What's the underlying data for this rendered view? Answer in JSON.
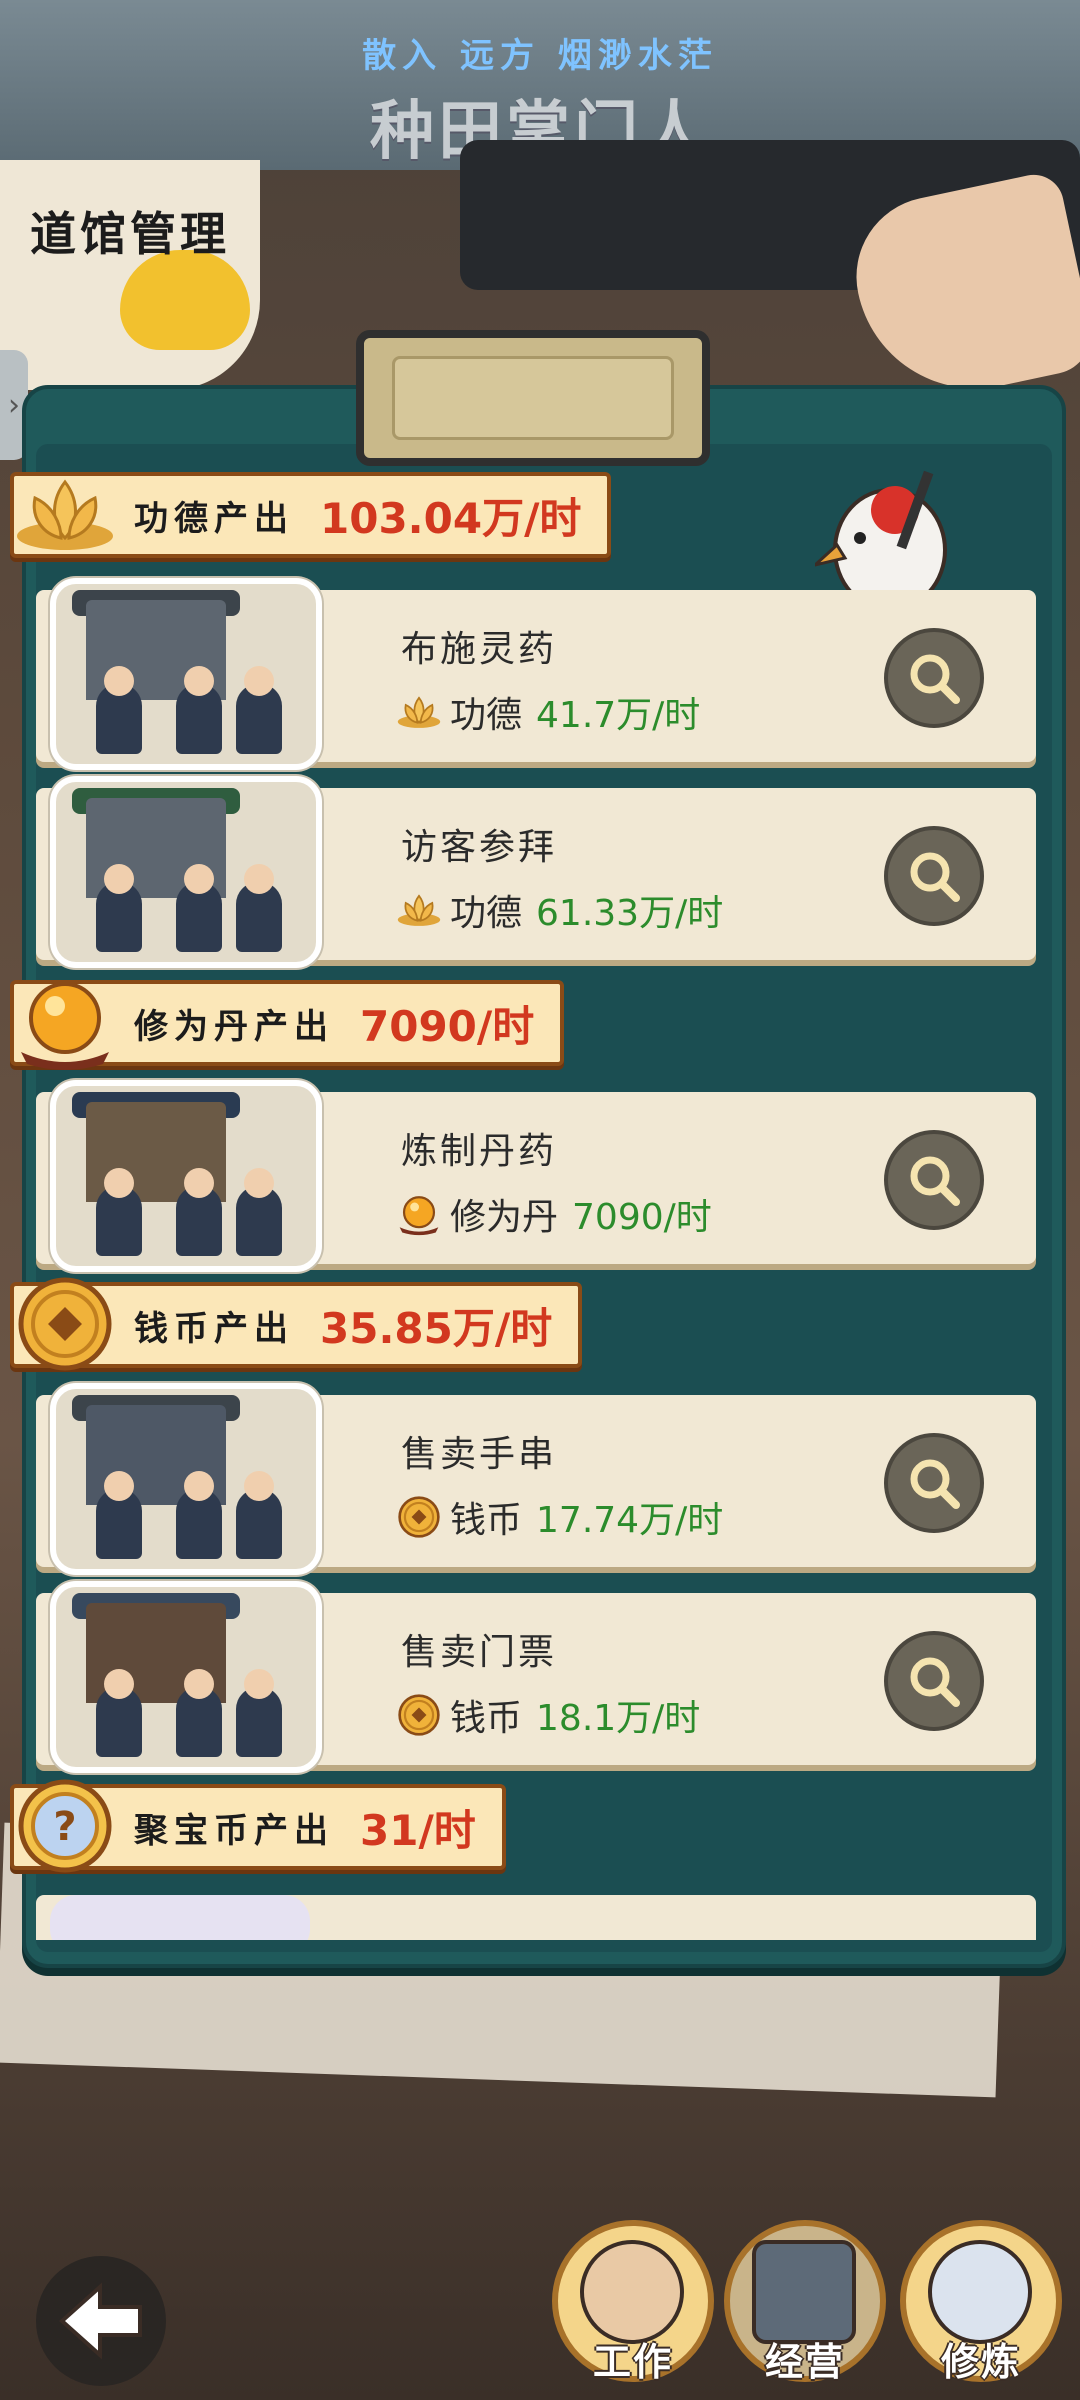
{
  "banner": {
    "scroll_text": "散入 远方 烟渺水茫",
    "logo": "种田掌门人"
  },
  "page_title": "道馆管理",
  "colors": {
    "board": "#1f5a5b",
    "ribbon": "#fbe7b8",
    "value_red": "#d2381f",
    "value_green": "#2c8c2c"
  },
  "sections": [
    {
      "label": "功德产出",
      "value": "103.04万/时",
      "icon": "lotus-icon",
      "rows": [
        {
          "title": "布施灵药",
          "currency": "功德",
          "rate": "41.7万/时",
          "icon": "lotus-icon"
        },
        {
          "title": "访客参拜",
          "currency": "功德",
          "rate": "61.33万/时",
          "icon": "lotus-icon"
        }
      ]
    },
    {
      "label": "修为丹产出",
      "value": "7090/时",
      "icon": "elixir-pill-icon",
      "rows": [
        {
          "title": "炼制丹药",
          "currency": "修为丹",
          "rate": "7090/时",
          "icon": "elixir-pill-icon"
        }
      ]
    },
    {
      "label": "钱币产出",
      "value": "35.85万/时",
      "icon": "coin-icon",
      "rows": [
        {
          "title": "售卖手串",
          "currency": "钱币",
          "rate": "17.74万/时",
          "icon": "coin-icon"
        },
        {
          "title": "售卖门票",
          "currency": "钱币",
          "rate": "18.1万/时",
          "icon": "coin-icon"
        }
      ]
    },
    {
      "label": "聚宝币产出",
      "value": "31/时",
      "icon": "treasure-coin-icon",
      "rows": []
    }
  ],
  "nav": [
    {
      "label": "工作",
      "icon": "disciple-avatar-icon"
    },
    {
      "label": "经营",
      "icon": "temple-building-icon"
    },
    {
      "label": "修炼",
      "icon": "cultivator-avatar-icon"
    }
  ]
}
